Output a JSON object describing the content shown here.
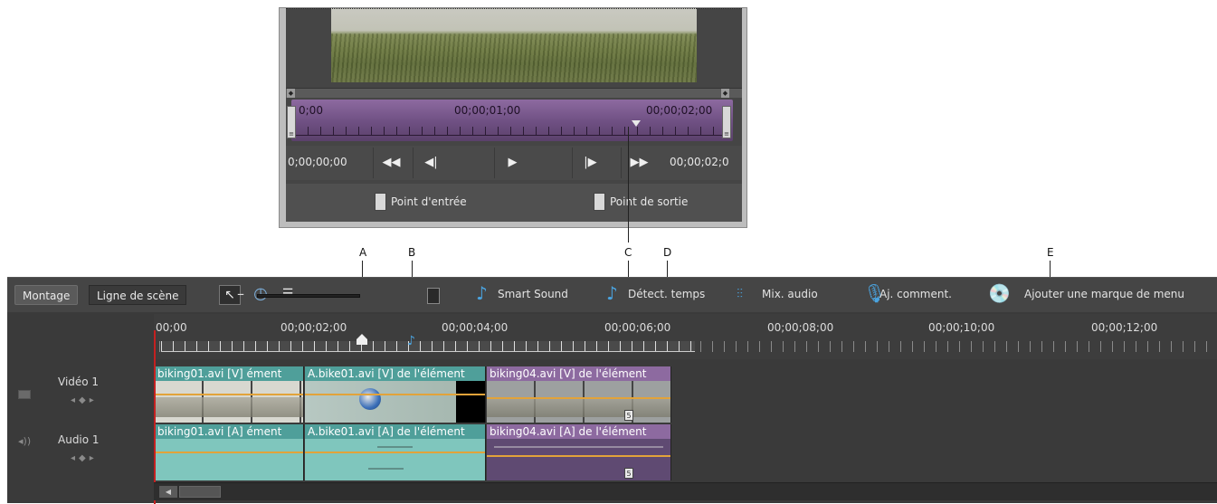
{
  "monitor": {
    "timecodes": [
      "0;00",
      "00;00;01;00",
      "00;00;02;00"
    ],
    "current_time": "0;00;00;00",
    "end_time": "00;00;02;0",
    "transport": [
      "◀◀",
      "◀|",
      "▶",
      "|▶",
      "▶▶"
    ],
    "in_point_label": "Point d'entrée",
    "out_point_label": "Point de sortie"
  },
  "callouts": [
    "A",
    "B",
    "C",
    "D",
    "E"
  ],
  "timeline": {
    "tabs": [
      "Montage",
      "Ligne de scène"
    ],
    "toolbar": {
      "zoom_out": "–",
      "smart_sound": "Smart Sound",
      "detect_tempo": "Détect. temps",
      "mix_audio": "Mix. audio",
      "add_comment": "Aj. comment.",
      "add_menu_marker": "Ajouter une marque de menu"
    },
    "ruler": [
      "00;00",
      "00;00;02;00",
      "00;00;04;00",
      "00;00;06;00",
      "00;00;08;00",
      "00;00;10;00",
      "00;00;12;00"
    ],
    "tracks": {
      "video": {
        "name": "Vidéo 1",
        "clips": [
          "biking01.avi [V] ément",
          "A.bike01.avi [V] de l'élément",
          "biking04.avi [V] de l'élément"
        ]
      },
      "audio": {
        "name": "Audio 1",
        "clips": [
          "biking01.avi [A] ément",
          "A.bike01.avi [A] de l'élément",
          "biking04.avi [A] de l'élément"
        ]
      }
    },
    "marker_number": "5"
  }
}
